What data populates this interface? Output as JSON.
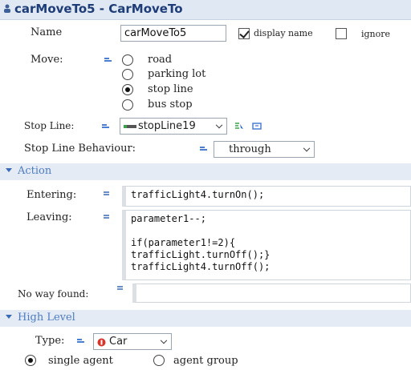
{
  "window": {
    "title": "carMoveTo5 - CarMoveTo"
  },
  "name_row": {
    "label": "Name",
    "value": "carMoveTo5",
    "display_name_label": "display name",
    "ignore_label": "ignore"
  },
  "move": {
    "label": "Move:",
    "options": [
      "road",
      "parking lot",
      "stop line",
      "bus stop"
    ],
    "selected": "stop line"
  },
  "stop_line": {
    "label": "Stop Line:",
    "value": "stopLine19"
  },
  "stop_line_behaviour": {
    "label": "Stop Line Behaviour:",
    "value": "through"
  },
  "action_section": {
    "title": "Action",
    "entering_label": "Entering:",
    "entering_code": "trafficLight4.turnOn();",
    "leaving_label": "Leaving:",
    "leaving_code": "parameter1--;\n\nif(parameter1!=2){\ntrafficLight.turnOff();}\ntrafficLight4.turnOff();",
    "no_way_label": "No way found:",
    "no_way_code": ""
  },
  "high_level_section": {
    "title": "High Level",
    "type_label": "Type:",
    "type_value": "Car",
    "agent_options": [
      "single agent",
      "agent group"
    ],
    "agent_selected": "single agent"
  },
  "colors": {
    "title_text": "#1e3d78",
    "section_text": "#4d7cc4",
    "section_bg": "#e4ebf4",
    "accent_red": "#d9342b"
  },
  "icons": [
    "agent-icon",
    "equals-icon",
    "stopline-icon",
    "select-icon",
    "create-icon",
    "car-icon"
  ]
}
